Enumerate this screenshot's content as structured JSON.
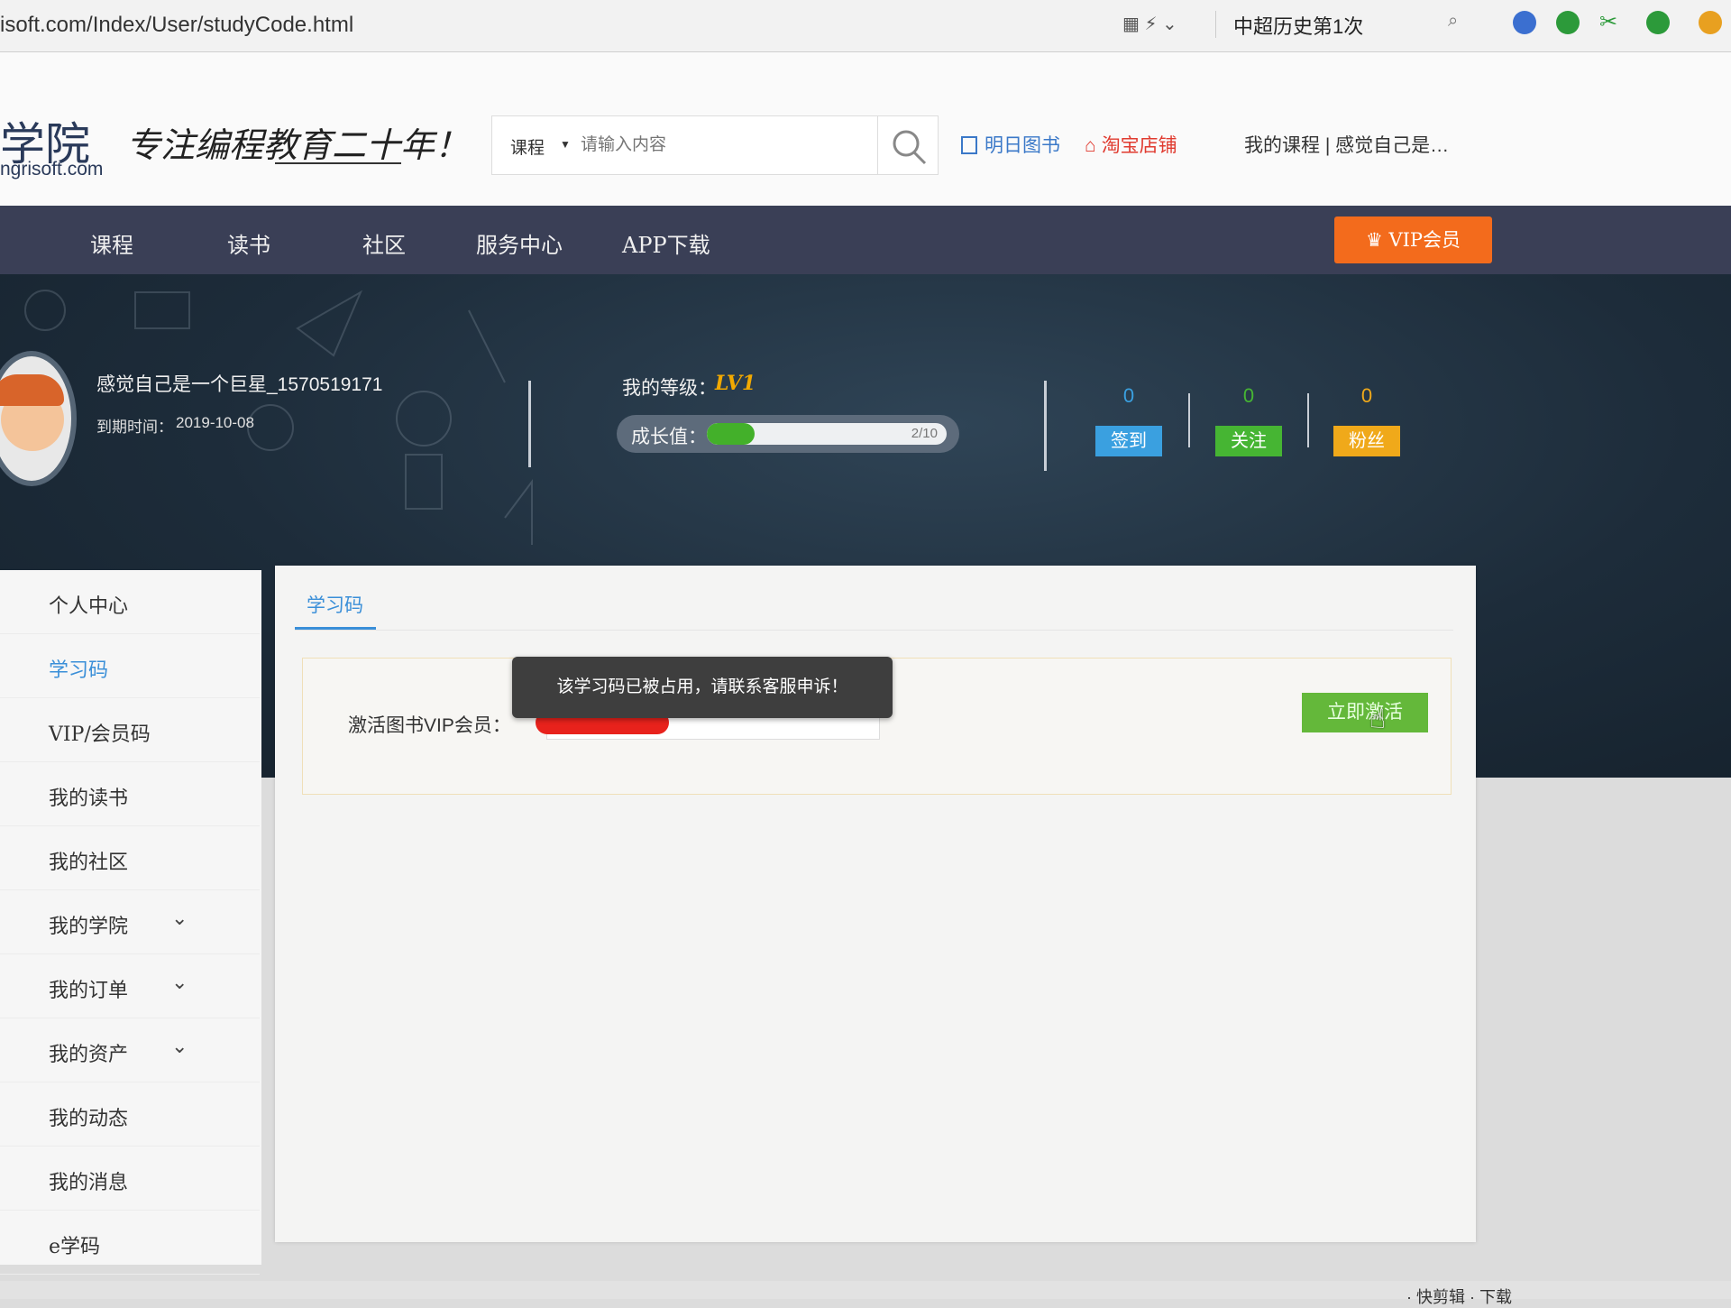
{
  "browser": {
    "url": "isoft.com/Index/User/studyCode.html",
    "search_text": "中超历史第1次",
    "bottom_status": "· 快剪辑 · 下载"
  },
  "header": {
    "logo_text": "学院",
    "logo_url": "ngrisoft.com",
    "slogan": "专注编程教育二十年！",
    "search": {
      "category": "课程",
      "placeholder": "请输入内容"
    },
    "links": {
      "books": "明日图书",
      "taobao": "淘宝店铺",
      "user": "我的课程 | 感觉自己是…"
    }
  },
  "nav": {
    "items": [
      "课程",
      "读书",
      "社区",
      "服务中心",
      "APP下载"
    ],
    "vip": "VIP会员"
  },
  "profile": {
    "username": "感觉自己是一个巨星_1570519171",
    "expiry_label": "到期时间：",
    "expiry_date": "2019-10-08",
    "level_label": "我的等级：",
    "level": "LV1",
    "growth_label": "成长值：",
    "growth_text": "2/10",
    "growth_fraction": 0.2,
    "stats": [
      {
        "label": "签到",
        "value": "0",
        "color": "#3aa0e0"
      },
      {
        "label": "关注",
        "value": "0",
        "color": "#46b533"
      },
      {
        "label": "粉丝",
        "value": "0",
        "color": "#f0a91a"
      }
    ]
  },
  "sidebar": {
    "items": [
      {
        "label": "个人中心",
        "chevron": false,
        "active": false
      },
      {
        "label": "学习码",
        "chevron": false,
        "active": true
      },
      {
        "label": "VIP/会员码",
        "chevron": false,
        "active": false
      },
      {
        "label": "我的读书",
        "chevron": false,
        "active": false
      },
      {
        "label": "我的社区",
        "chevron": false,
        "active": false
      },
      {
        "label": "我的学院",
        "chevron": true,
        "active": false
      },
      {
        "label": "我的订单",
        "chevron": true,
        "active": false
      },
      {
        "label": "我的资产",
        "chevron": true,
        "active": false
      },
      {
        "label": "我的动态",
        "chevron": false,
        "active": false
      },
      {
        "label": "我的消息",
        "chevron": false,
        "active": false
      },
      {
        "label": "e学码",
        "chevron": false,
        "active": false
      }
    ]
  },
  "main": {
    "tab": "学习码",
    "form_label": "激活图书VIP会员：",
    "activate_button": "立即激活",
    "toast": "该学习码已被占用，请联系客服申诉！"
  },
  "colors": {
    "accent": "#3a8fd8",
    "nav_bg": "#3a3f56",
    "vip": "#f36b1c",
    "activate": "#64b83a",
    "level": "#f2a900"
  }
}
